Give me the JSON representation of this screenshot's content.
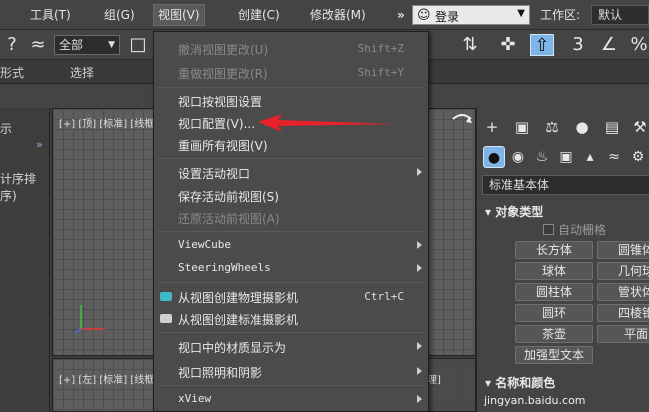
{
  "menubar": {
    "items": [
      "工具(T)",
      "组(G)",
      "视图(V)",
      "创建(C)",
      "修改器(M)"
    ],
    "overflow": "»",
    "login_label": "登录",
    "workspace_label": "工作区:",
    "workspace_value": "默认"
  },
  "toolbar": {
    "selection_filter": "全部"
  },
  "ribbon": {
    "items": [
      "形式",
      "选择"
    ]
  },
  "left_panel": {
    "items": [
      "示",
      "计序排序)"
    ]
  },
  "viewports": {
    "top_label": "[+] [顶] [标准] [线框]",
    "left_label": "[+] [左] [标准] [线框]",
    "persp_label_frag": "理]"
  },
  "view_menu": {
    "items": [
      {
        "label": "撤消视图更改(U)",
        "shortcut": "Shift+Z",
        "disabled": true
      },
      {
        "label": "重做视图更改(R)",
        "shortcut": "Shift+Y",
        "disabled": true
      },
      {
        "label": "视口按视图设置",
        "shortcut": "",
        "disabled": false
      },
      {
        "label": "视口配置(V)...",
        "shortcut": "",
        "disabled": false
      },
      {
        "label": "重画所有视图(V)",
        "shortcut": "",
        "disabled": false
      },
      {
        "label": "设置活动视口",
        "shortcut": "",
        "disabled": false
      },
      {
        "label": "保存活动前视图(S)",
        "shortcut": "",
        "disabled": false
      },
      {
        "label": "还原活动前视图(A)",
        "shortcut": "",
        "disabled": true
      },
      {
        "label": "ViewCube",
        "shortcut": "",
        "disabled": false
      },
      {
        "label": "SteeringWheels",
        "shortcut": "",
        "disabled": false
      },
      {
        "label": "从视图创建物理摄影机",
        "shortcut": "Ctrl+C",
        "disabled": false
      },
      {
        "label": "从视图创建标准摄影机",
        "shortcut": "",
        "disabled": false
      },
      {
        "label": "视口中的材质显示为",
        "shortcut": "",
        "disabled": false
      },
      {
        "label": "视口照明和阴影",
        "shortcut": "",
        "disabled": false
      },
      {
        "label": "xView",
        "shortcut": "",
        "disabled": false
      }
    ]
  },
  "command_panel": {
    "category_select": "标准基本体",
    "object_type_title": "对象类型",
    "autogrid_label": "自动栅格",
    "buttons": [
      "长方体",
      "圆锥体",
      "球体",
      "几何球",
      "圆柱体",
      "管状体",
      "圆环",
      "四棱锥",
      "茶壶",
      "平面",
      "加强型文本"
    ],
    "name_color_title": "名称和颜色"
  },
  "watermark": "jingyan.baidu.com",
  "colors": {
    "accent_blue": "#7fb4e6",
    "arrow_red": "#e8222a"
  }
}
